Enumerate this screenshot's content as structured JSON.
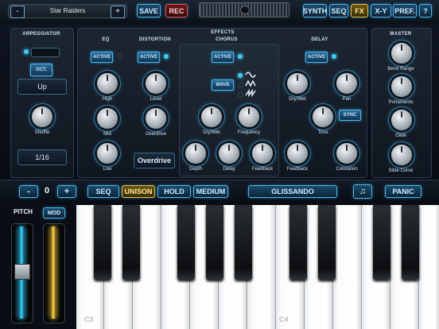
{
  "top": {
    "preset_name": "Star Raiders",
    "prev_label": "-",
    "next_label": "+",
    "save": "SAVE",
    "rec": "REC",
    "synth": "SYNTH",
    "seq": "SEQ",
    "fx": "FX",
    "xy": "X-Y",
    "pref": "PREF.",
    "help": "?"
  },
  "arpeggiator": {
    "title": "ARPEGGIATOR",
    "oct": "OCT.",
    "direction": "Up",
    "shuffle_label": "Shuffle",
    "rate": "1/16"
  },
  "effects": {
    "title": "EFFECTS",
    "active": "ACTIVE",
    "eq": {
      "title": "EQ",
      "high": "High",
      "mid": "Mid",
      "low": "Low"
    },
    "distortion": {
      "title": "DISTORTION",
      "level": "Level",
      "overdrive": "Overdrive",
      "type": "Overdrive"
    },
    "chorus": {
      "title": "CHORUS",
      "wave": "WAVE",
      "drywet": "Dry/Wet",
      "frequency": "Frequency",
      "depth": "Depth",
      "delay": "Delay",
      "feedback": "Feedback"
    },
    "delay": {
      "title": "DELAY",
      "drywet": "Dry/Wet",
      "pan": "Pan",
      "time": "Time",
      "sync": "SYNC",
      "feedback": "Feedback",
      "coloration": "Coloration"
    }
  },
  "master": {
    "title": "MASTER",
    "bend_range": "Bend Range",
    "portamento": "Portamento",
    "glide": "Glide",
    "slide_curve": "Slide Curve"
  },
  "controls": {
    "octave_down": "-",
    "octave_value": "0",
    "octave_up": "+",
    "seq": "SEQ",
    "unison": "UNISON",
    "hold": "HOLD",
    "medium": "MEDIUM",
    "glissando": "GLISSANDO",
    "note_icon": "music-note-icon",
    "panic": "PANIC"
  },
  "wheels": {
    "pitch": "PITCH",
    "mod": "MOD"
  },
  "keyboard": {
    "c3": "C3",
    "c4": "C4"
  },
  "colors": {
    "accent": "#4fb6e8",
    "fx_active": "#e8c040",
    "rec": "#e05050"
  }
}
